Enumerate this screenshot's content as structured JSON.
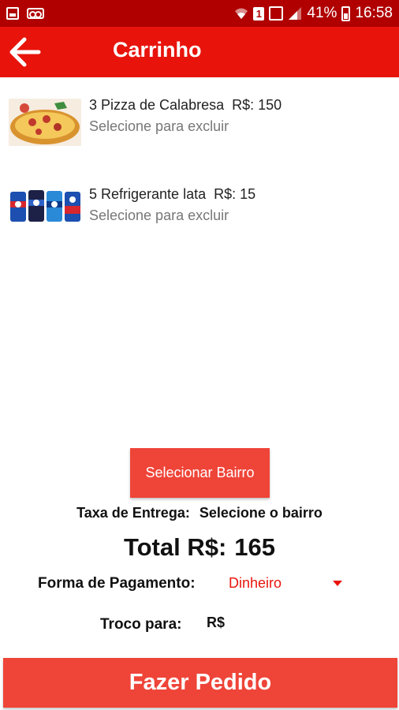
{
  "status_bar": {
    "battery": "41%",
    "time": "16:58",
    "sim_badge": "1",
    "icons": [
      "gallery-icon",
      "voicemail-icon",
      "wifi-icon",
      "sim-badge",
      "no-sim-icon",
      "signal-icon",
      "battery-icon"
    ]
  },
  "app_bar": {
    "title": "Carrinho",
    "back_icon": "arrow-left-icon"
  },
  "cart": {
    "items": [
      {
        "label": "3 Pizza de Calabresa",
        "price": "R$: 150",
        "hint": "Selecione para excluir",
        "image": "pizza-image"
      },
      {
        "label": "5 Refrigerante lata",
        "price": "R$: 15",
        "hint": "Selecione para excluir",
        "image": "soda-cans-image"
      }
    ]
  },
  "summary": {
    "select_neighborhood_button": "Selecionar Bairro",
    "delivery_fee_label": "Taxa de Entrega:",
    "delivery_fee_value": "Selecione o bairro",
    "total_label": "Total R$:",
    "total_value": "165",
    "payment_label": "Forma de Pagamento:",
    "payment_selected": "Dinheiro",
    "change_label": "Troco para:",
    "change_value": "R$"
  },
  "actions": {
    "place_order": "Fazer Pedido"
  },
  "colors": {
    "status_bar": "#b00000",
    "app_bar": "#e8140c",
    "button": "#ef4438",
    "accent_text": "#e8140c"
  }
}
